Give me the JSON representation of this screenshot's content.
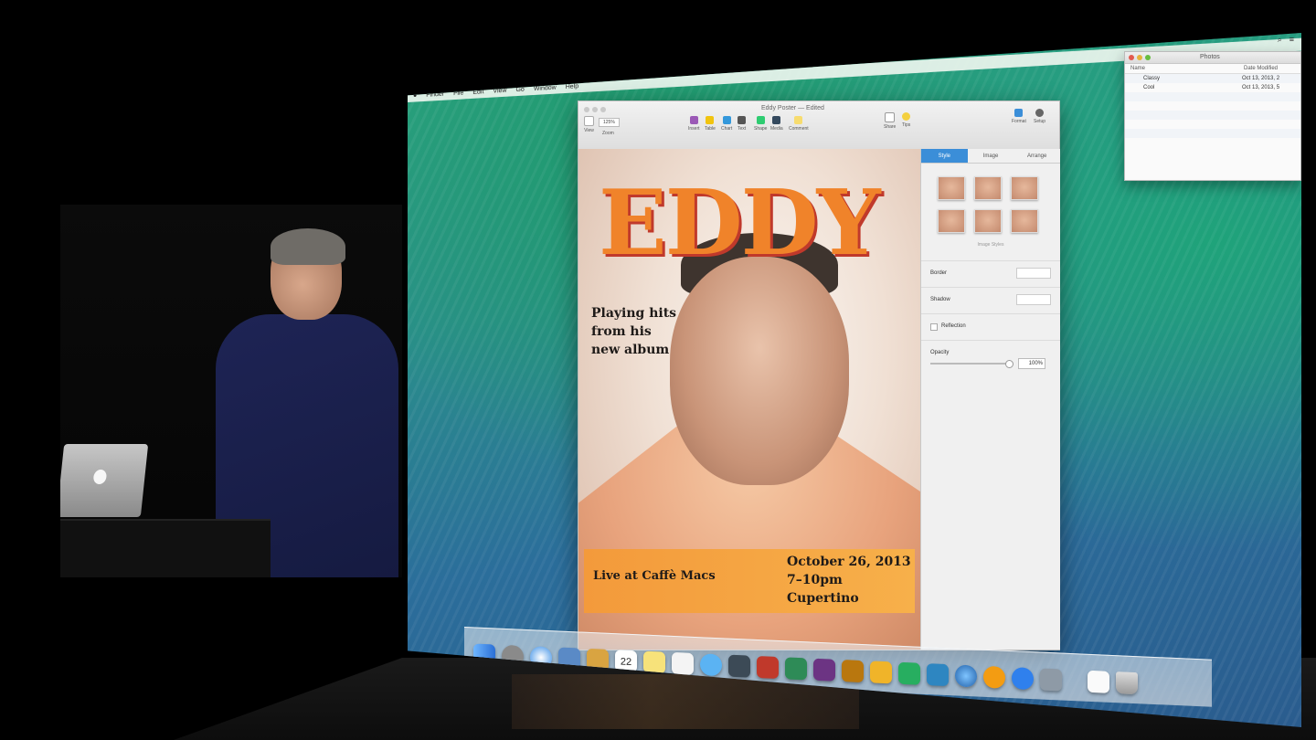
{
  "menubar": {
    "items": [
      "Finder",
      "File",
      "Edit",
      "View",
      "Go",
      "Window",
      "Help"
    ]
  },
  "pages_window": {
    "doc_title": "Eddy Poster — Edited",
    "toolbar": {
      "view_label": "View",
      "zoom_value": "125%",
      "zoom_label": "Zoom",
      "tools": [
        "Insert",
        "Table",
        "Chart",
        "Text",
        "Shape",
        "Media",
        "Comment"
      ],
      "share_label": "Share",
      "tips_label": "Tips",
      "format_label": "Format",
      "setup_label": "Setup"
    },
    "poster": {
      "title": "EDDY",
      "subtitle_lines": [
        "Playing hits",
        "from his",
        "new album"
      ],
      "banner_left": "Live at Caffè Macs",
      "banner_right_lines": [
        "October 26, 2013",
        "7–10pm",
        "Cupertino"
      ]
    },
    "inspector": {
      "tabs": [
        "Style",
        "Image",
        "Arrange"
      ],
      "image_styles_label": "Image Styles",
      "border_label": "Border",
      "shadow_label": "Shadow",
      "reflection_label": "Reflection",
      "opacity_label": "Opacity",
      "opacity_value": "100%"
    }
  },
  "finder_window": {
    "title": "Photos",
    "col_name": "Name",
    "col_date": "Date Modified",
    "rows": [
      {
        "name": "Classy",
        "date": "Oct 13, 2013, 2"
      },
      {
        "name": "Cool",
        "date": "Oct 13, 2013, 5"
      }
    ]
  },
  "dock": {
    "apps": [
      "finder-icon",
      "launchpad-icon",
      "safari-icon",
      "mail-icon",
      "contacts-icon",
      "calendar-icon",
      "notes-icon",
      "reminders-icon",
      "messages-icon",
      "facetime-icon",
      "photo-booth-icon",
      "iphoto-icon",
      "imovie-icon",
      "garageband-icon",
      "pages-icon",
      "numbers-icon",
      "keynote-icon",
      "itunes-icon",
      "ibooks-icon",
      "app-store-icon",
      "system-preferences-icon",
      "document-icon",
      "trash-icon"
    ],
    "calendar_day": "22"
  }
}
